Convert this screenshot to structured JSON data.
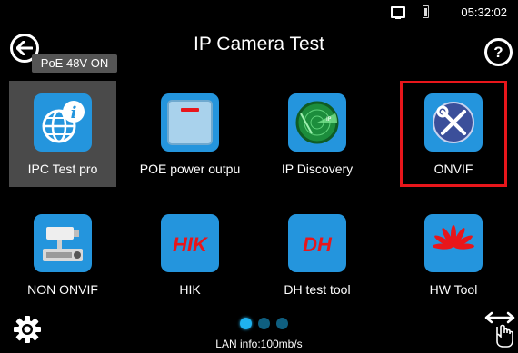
{
  "status_bar": {
    "time": "05:32:02",
    "icons": [
      "monitor-icon",
      "battery-icon"
    ]
  },
  "header": {
    "title": "IP Camera Test",
    "poe_badge": "PoE 48V ON",
    "back_icon": "back-arrow-icon",
    "help_icon": "?"
  },
  "tiles": [
    {
      "label": "IPC Test pro",
      "icon": "globe-info-icon",
      "state": "selected"
    },
    {
      "label": "POE power outpu",
      "icon": "power-switch-icon",
      "state": "normal"
    },
    {
      "label": "IP Discovery",
      "icon": "radar-icon",
      "state": "normal"
    },
    {
      "label": "ONVIF",
      "icon": "wrench-screwdriver-icon",
      "state": "focused"
    },
    {
      "label": "NON ONVIF",
      "icon": "cctv-camera-icon",
      "state": "normal"
    },
    {
      "label": "HIK",
      "icon": "hik-logo-icon",
      "logo_text": "HIK",
      "state": "normal"
    },
    {
      "label": "DH test tool",
      "icon": "dh-logo-icon",
      "logo_text": "DH",
      "state": "normal"
    },
    {
      "label": "HW Tool",
      "icon": "huawei-logo-icon",
      "state": "normal"
    }
  ],
  "footer": {
    "lan_info": "LAN info:100mb/s",
    "page_indicator": {
      "pages": 3,
      "active": 1
    },
    "settings_icon": "gear-icon",
    "swipe_icon": "swipe-hand-icon"
  },
  "colors": {
    "background": "#000000",
    "tile_blue": "#2495dd",
    "focus_red": "#e8161b",
    "selected_gray": "#4a4a4a",
    "brand_red": "#e8161b"
  }
}
